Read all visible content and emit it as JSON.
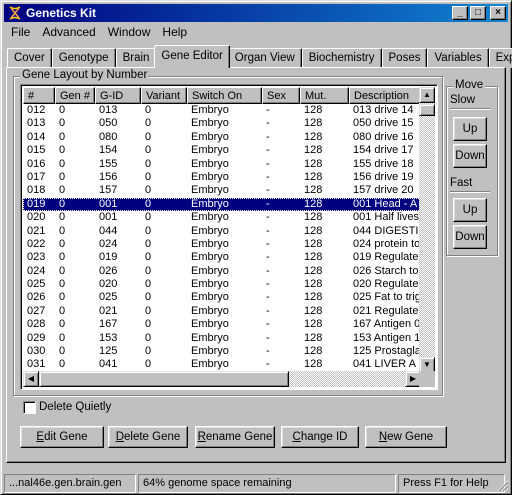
{
  "window": {
    "title": "Genetics Kit",
    "minimize": "_",
    "maximize": "□",
    "close": "×"
  },
  "menu": [
    "File",
    "Advanced",
    "Window",
    "Help"
  ],
  "tabs": [
    "Cover",
    "Genotype",
    "Brain",
    "Gene Editor",
    "Organ View",
    "Biochemistry",
    "Poses",
    "Variables",
    "Export"
  ],
  "active_tab": "Gene Editor",
  "gene_layout": {
    "group_label": "Gene Layout by Number",
    "columns": [
      "#",
      "Gen #",
      "G-ID",
      "Variant",
      "Switch On",
      "Sex",
      "Mut.",
      "Description"
    ],
    "rows": [
      [
        "012",
        "0",
        "013",
        "0",
        "Embryo",
        "-",
        "128",
        "013 drive 14"
      ],
      [
        "013",
        "0",
        "050",
        "0",
        "Embryo",
        "-",
        "128",
        "050 drive 15"
      ],
      [
        "014",
        "0",
        "080",
        "0",
        "Embryo",
        "-",
        "128",
        "080 drive 16"
      ],
      [
        "015",
        "0",
        "154",
        "0",
        "Embryo",
        "-",
        "128",
        "154 drive 17"
      ],
      [
        "016",
        "0",
        "155",
        "0",
        "Embryo",
        "-",
        "128",
        "155 drive 18"
      ],
      [
        "017",
        "0",
        "156",
        "0",
        "Embryo",
        "-",
        "128",
        "156 drive 19"
      ],
      [
        "018",
        "0",
        "157",
        "0",
        "Embryo",
        "-",
        "128",
        "157 drive 20"
      ],
      [
        "019",
        "0",
        "001",
        "0",
        "Embryo",
        "-",
        "128",
        "001 Head - A"
      ],
      [
        "020",
        "0",
        "001",
        "0",
        "Embryo",
        "-",
        "128",
        "001 Half lives"
      ],
      [
        "021",
        "0",
        "044",
        "0",
        "Embryo",
        "-",
        "128",
        "044 DIGESTI"
      ],
      [
        "022",
        "0",
        "024",
        "0",
        "Embryo",
        "-",
        "128",
        "024 protein to"
      ],
      [
        "023",
        "0",
        "019",
        "0",
        "Embryo",
        "-",
        "128",
        "019 Regulate"
      ],
      [
        "024",
        "0",
        "026",
        "0",
        "Embryo",
        "-",
        "128",
        "026 Starch to"
      ],
      [
        "025",
        "0",
        "020",
        "0",
        "Embryo",
        "-",
        "128",
        "020 Regulate"
      ],
      [
        "026",
        "0",
        "025",
        "0",
        "Embryo",
        "-",
        "128",
        "025 Fat to trig"
      ],
      [
        "027",
        "0",
        "021",
        "0",
        "Embryo",
        "-",
        "128",
        "021 Regulate"
      ],
      [
        "028",
        "0",
        "167",
        "0",
        "Embryo",
        "-",
        "128",
        "167 Antigen 0"
      ],
      [
        "029",
        "0",
        "153",
        "0",
        "Embryo",
        "-",
        "128",
        "153 Antigen 1"
      ],
      [
        "030",
        "0",
        "125",
        "0",
        "Embryo",
        "-",
        "128",
        "125 Prostagla"
      ],
      [
        "031",
        "0",
        "041",
        "0",
        "Embryo",
        "-",
        "128",
        "041 LIVER A"
      ]
    ],
    "selected_row": "019"
  },
  "move": {
    "group_label": "Move",
    "slow_label": "Slow",
    "fast_label": "Fast",
    "up": "Up",
    "down": "Down"
  },
  "delete_quietly": {
    "label": "Delete Quietly",
    "checked": false
  },
  "actions": {
    "edit": "Edit Gene",
    "delete": "Delete Gene",
    "rename": "Rename Gene",
    "change_id": "Change ID",
    "new": "New Gene"
  },
  "status": {
    "file": "...nal46e.gen.brain.gen",
    "space": "64% genome space remaining",
    "help": "Press F1 for Help"
  },
  "colors": {
    "title_start": "#000080",
    "title_end": "#1084d0",
    "selection": "#000080",
    "face": "#c0c0c0"
  }
}
